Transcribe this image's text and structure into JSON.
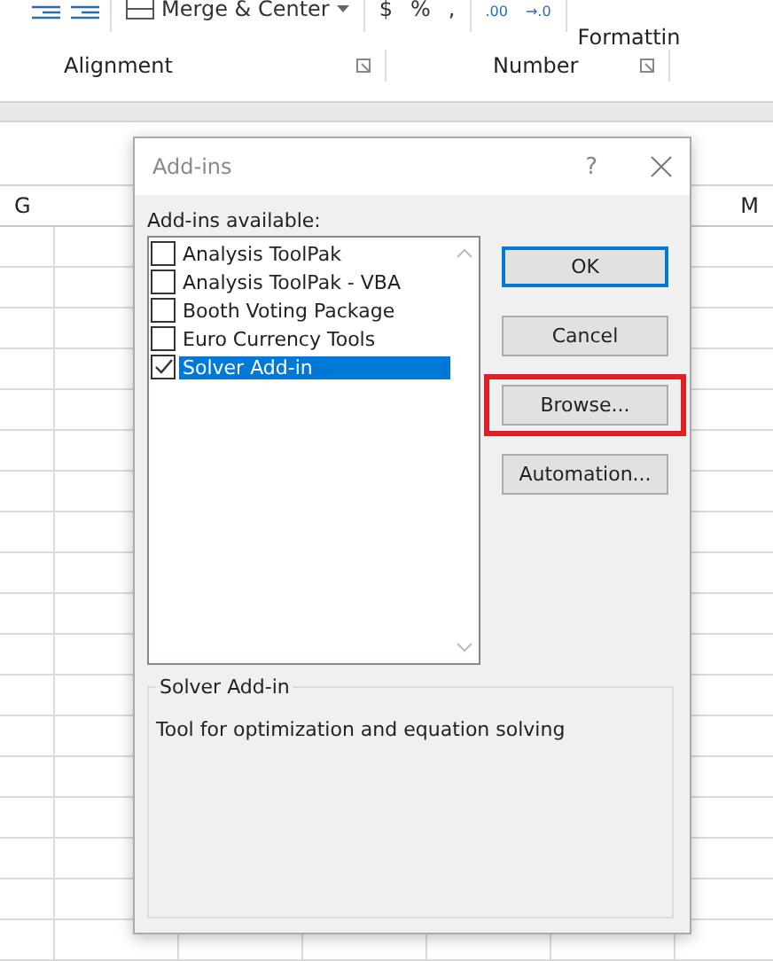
{
  "ribbon": {
    "merge_button": "Merge & Center",
    "number_buttons": [
      "$",
      "%",
      ","
    ],
    "decimal_buttons": [
      ".00",
      "→.0"
    ],
    "styles_label": "Formattin",
    "groups": [
      "Alignment",
      "Number"
    ]
  },
  "sheet": {
    "column_headers": [
      "G",
      "M"
    ]
  },
  "dialog": {
    "title": "Add-ins",
    "help": "?",
    "list_label": "Add-ins available:",
    "items": [
      {
        "label": "Analysis ToolPak",
        "checked": false,
        "selected": false
      },
      {
        "label": "Analysis ToolPak - VBA",
        "checked": false,
        "selected": false
      },
      {
        "label": "Booth Voting Package",
        "checked": false,
        "selected": false
      },
      {
        "label": "Euro Currency Tools",
        "checked": false,
        "selected": false
      },
      {
        "label": "Solver Add-in",
        "checked": true,
        "selected": true
      }
    ],
    "buttons": [
      {
        "label": "OK",
        "default": true,
        "highlighted": false
      },
      {
        "label": "Cancel",
        "default": false,
        "highlighted": false
      },
      {
        "label": "Browse...",
        "default": false,
        "highlighted": true
      },
      {
        "label": "Automation...",
        "default": false,
        "highlighted": false
      }
    ],
    "description": {
      "title": "Solver Add-in",
      "text": "Tool for optimization and equation solving"
    }
  }
}
